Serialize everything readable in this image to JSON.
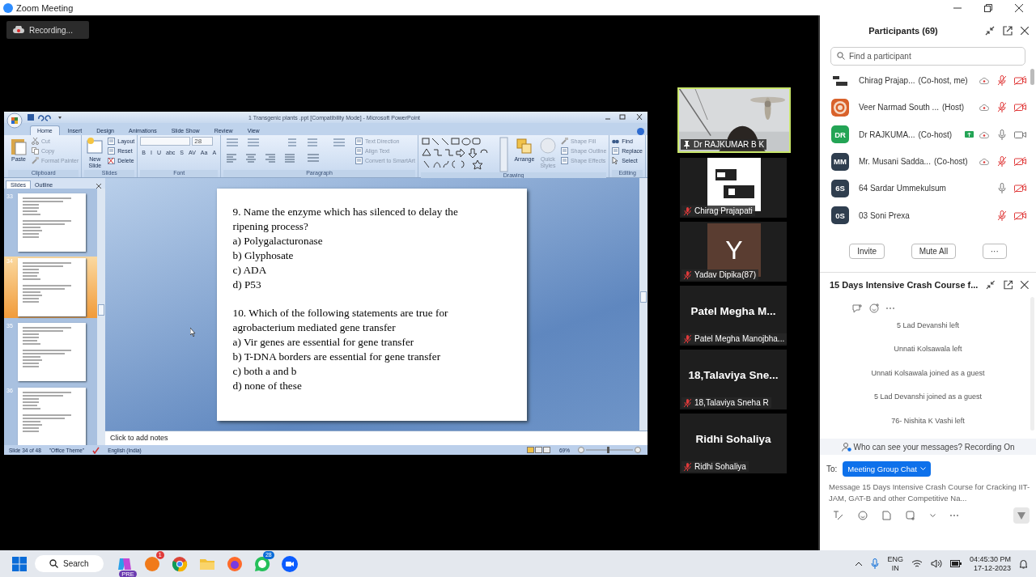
{
  "window": {
    "title": "Zoom Meeting"
  },
  "recording": {
    "label": "Recording...",
    "on": true
  },
  "ppt": {
    "title": "1 Transgenic plants .ppt [Compatibility Mode] - Microsoft PowerPoint",
    "tabs": [
      {
        "label": "Home",
        "selected": true
      },
      {
        "label": "Insert",
        "selected": false
      },
      {
        "label": "Design",
        "selected": false
      },
      {
        "label": "Animations",
        "selected": false
      },
      {
        "label": "Slide Show",
        "selected": false
      },
      {
        "label": "Review",
        "selected": false
      },
      {
        "label": "View",
        "selected": false
      }
    ],
    "groups": [
      {
        "kind": "buttons",
        "name": "Clipboard",
        "large": [
          {
            "label": "Paste",
            "disabled": false
          }
        ],
        "small": [
          {
            "label": "Cut",
            "disabled": true
          },
          {
            "label": "Copy",
            "disabled": true
          },
          {
            "label": "Format Painter",
            "disabled": true
          }
        ]
      },
      {
        "kind": "buttons",
        "name": "Slides",
        "large": [
          {
            "label": "New Slide",
            "disabled": false
          }
        ],
        "small": [
          {
            "label": "Layout",
            "disabled": false
          },
          {
            "label": "Reset",
            "disabled": false
          },
          {
            "label": "Delete",
            "disabled": false
          }
        ]
      },
      {
        "kind": "font",
        "name": "Font",
        "size": "28",
        "formats": [
          "B",
          "I",
          "U",
          "abc",
          "S",
          "AV",
          "Aa",
          "A"
        ]
      },
      {
        "kind": "paragraph",
        "name": "Paragraph",
        "small": [
          {
            "label": "Text Direction",
            "disabled": true
          },
          {
            "label": "Align Text",
            "disabled": true
          },
          {
            "label": "Convert to SmartArt",
            "disabled": true
          }
        ]
      },
      {
        "kind": "drawing",
        "name": "Drawing",
        "large": [
          {
            "label": "Arrange",
            "disabled": false
          },
          {
            "label": "Quick Styles",
            "disabled": true
          }
        ],
        "small": [
          {
            "label": "Shape Fill",
            "disabled": true
          },
          {
            "label": "Shape Outline",
            "disabled": true
          },
          {
            "label": "Shape Effects",
            "disabled": true
          }
        ]
      },
      {
        "kind": "buttons",
        "name": "Editing",
        "small": [
          {
            "label": "Find",
            "disabled": false
          },
          {
            "label": "Replace",
            "disabled": false
          },
          {
            "label": "Select",
            "disabled": false
          }
        ]
      }
    ],
    "pane_tabs": [
      {
        "label": "Slides",
        "selected": true
      },
      {
        "label": "Outline",
        "selected": false
      }
    ],
    "thumbnails": [
      {
        "number": "33",
        "selected": false
      },
      {
        "number": "34",
        "selected": true
      },
      {
        "number": "35",
        "selected": false
      },
      {
        "number": "36",
        "selected": false
      }
    ],
    "slide": [
      {
        "question": "9. Name the enzyme which has silenced to delay the ripening process?",
        "options": [
          "a) Polygalacturonase",
          "b) Glyphosate",
          "c) ADA",
          "d) P53"
        ]
      },
      {
        "question": "10. Which of the following statements are true for agrobacterium mediated gene transfer",
        "options": [
          "a) Vir genes are essential for gene transfer",
          "b) T-DNA borders are essential for gene transfer",
          "c) both a and b",
          "d) none of these"
        ]
      }
    ],
    "notes": {
      "placeholder": "Click to add notes"
    },
    "status": {
      "slide": "Slide 34 of 48",
      "theme": "\"Office Theme\"",
      "language": "English (India)",
      "zoom": "69%"
    }
  },
  "videos": [
    {
      "kind": "camera",
      "name": "Dr RAJKUMAR B K",
      "selected": true,
      "pinned": true,
      "muted": false
    },
    {
      "name": "Chirag Prajapati",
      "selected": false,
      "pinned": false,
      "muted": true
    },
    {
      "kind": "letter",
      "letter": "Y",
      "name": "Yadav Dipika(87)",
      "selected": false,
      "pinned": false,
      "muted": true
    },
    {
      "kind": "name",
      "display": "Patel Megha M...",
      "name": "Patel Megha Manojbha...",
      "selected": false,
      "pinned": false,
      "muted": true
    },
    {
      "kind": "name",
      "display": "18,Talaviya  Sne...",
      "name": "18,Talaviya Sneha R",
      "selected": false,
      "pinned": false,
      "muted": true
    },
    {
      "kind": "name",
      "display": "Ridhi Sohaliya",
      "name": "Ridhi Sohaliya",
      "selected": false,
      "pinned": false,
      "muted": true
    }
  ],
  "participants": {
    "title": "Participants (69)",
    "search": {
      "placeholder": "Find a participant"
    },
    "list": [
      {
        "name": "Chirag Prajap...",
        "role": "(Co-host, me)",
        "sharing": false,
        "recording": true,
        "muted": true,
        "video_off": true
      },
      {
        "kind": "logo",
        "name": "Veer Narmad South ...",
        "role": "(Host)",
        "sharing": false,
        "recording": true,
        "muted": true,
        "video_off": true
      },
      {
        "kind": "initials",
        "initials": "DR",
        "color": "#23a455",
        "name": "Dr RAJKUMA...",
        "role": "(Co-host)",
        "sharing": true,
        "recording": true,
        "muted": false,
        "video_off": false
      },
      {
        "kind": "initials",
        "initials": "MM",
        "color": "#2f3e4f",
        "name": "Mr. Musani Sadda...",
        "role": "(Co-host)",
        "sharing": false,
        "recording": true,
        "muted": true,
        "video_off": true
      },
      {
        "kind": "initials",
        "initials": "6S",
        "color": "#2f3e4f",
        "name": "64 Sardar Ummekulsum",
        "sharing": false,
        "recording": false,
        "muted": false,
        "video_off": true
      },
      {
        "kind": "initials",
        "initials": "0S",
        "color": "#2f3e4f",
        "name": "03 Soni Prexa",
        "sharing": false,
        "recording": false,
        "muted": true,
        "video_off": true
      }
    ],
    "buttons": [
      "Invite",
      "Mute All",
      "···"
    ]
  },
  "chat": {
    "title": "15 Days Intensive Crash Course f...",
    "messages": [
      "5 Lad Devanshi left",
      "Unnati Kolsawala left",
      "Unnati Kolsawala joined as a guest",
      "5 Lad Devanshi joined as a guest",
      "76- Nishita K Vashi left"
    ],
    "notice": "Who can see your messages? Recording On",
    "to_label": "To:",
    "recipient": "Meeting Group Chat",
    "placeholder": "Message 15 Days Intensive Crash Course for Cracking IIT-JAM, GAT-B and other Competitive Na..."
  },
  "taskbar": {
    "search": "Search",
    "apps": [
      {
        "kind": "copilot",
        "badge": "PRE"
      },
      {
        "kind": "orange",
        "badge": "1"
      },
      {
        "kind": "chrome"
      },
      {
        "kind": "folder"
      },
      {
        "kind": "firefox"
      },
      {
        "kind": "whatsapp",
        "badge": "28"
      },
      {
        "kind": "zoom"
      }
    ],
    "language": [
      "ENG",
      "IN"
    ],
    "time": "04:45:30 PM",
    "date": "17-12-2023"
  }
}
